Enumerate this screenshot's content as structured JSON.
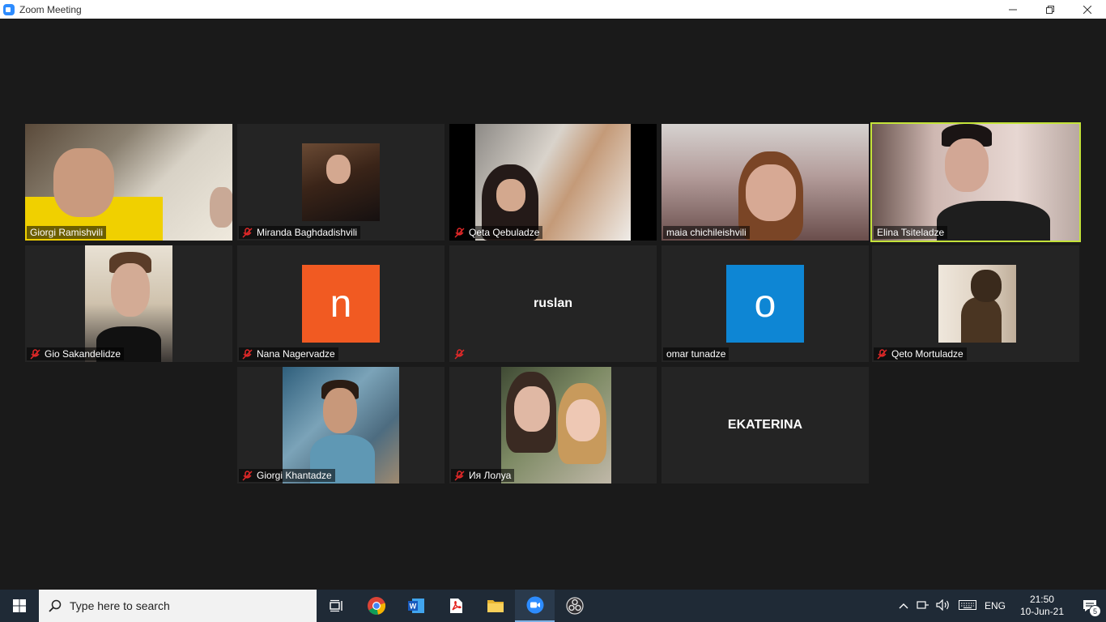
{
  "window": {
    "title": "Zoom Meeting"
  },
  "participants": [
    {
      "name": "Giorgi Ramishvili",
      "muted": false
    },
    {
      "name": "Miranda Baghdadishvili",
      "muted": true
    },
    {
      "name": "Qeta Qebuladze",
      "muted": true
    },
    {
      "name": "maia chichileishvili",
      "muted": false
    },
    {
      "name": "Elina Tsiteladze",
      "muted": false,
      "active_speaker": true
    },
    {
      "name": "Gio Sakandelidze",
      "muted": true
    },
    {
      "name": "Nana Nagervadze",
      "muted": true,
      "avatar_letter": "n",
      "avatar_color": "#f15a22"
    },
    {
      "name": "ruslan",
      "muted": true
    },
    {
      "name": "omar tunadze",
      "muted": false,
      "avatar_letter": "o",
      "avatar_color": "#0e86d4"
    },
    {
      "name": "Qeto Mortuladze",
      "muted": true
    },
    {
      "name": "Giorgi Khantadze",
      "muted": true
    },
    {
      "name": "Ия Лолуа",
      "muted": true
    },
    {
      "name": "EKATERINA",
      "muted": false
    }
  ],
  "taskbar": {
    "search_placeholder": "Type here to search",
    "language": "ENG",
    "time": "21:50",
    "date": "10-Jun-21",
    "notification_count": "5"
  },
  "colors": {
    "active_speaker_border": "#c4e33a",
    "mute_icon": "#e02828",
    "zoom_blue": "#2d8cff"
  }
}
